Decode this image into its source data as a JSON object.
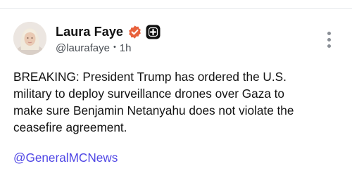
{
  "post": {
    "author": {
      "display_name": "Laura Faye",
      "handle": "@laurafaye",
      "avatar_icon": "profile-photo"
    },
    "separator": "•",
    "timestamp": "1h",
    "badges": {
      "verified_icon": "verified-check-icon",
      "verified_color": "#e8613c",
      "plus_icon": "plus-square-icon",
      "plus_color": "#111111"
    },
    "text_lines": [
      "BREAKING: President Trump has ordered the U.S.",
      "military to deploy surveillance drones over Gaza to",
      "make sure Benjamin Netanyahu does not violate the",
      "ceasefire agreement."
    ],
    "mention": "@GeneralMCNews",
    "more_icon": "more-vertical-icon"
  },
  "colors": {
    "link": "#4f46e5",
    "text": "#111111",
    "meta": "#4a4f55"
  }
}
